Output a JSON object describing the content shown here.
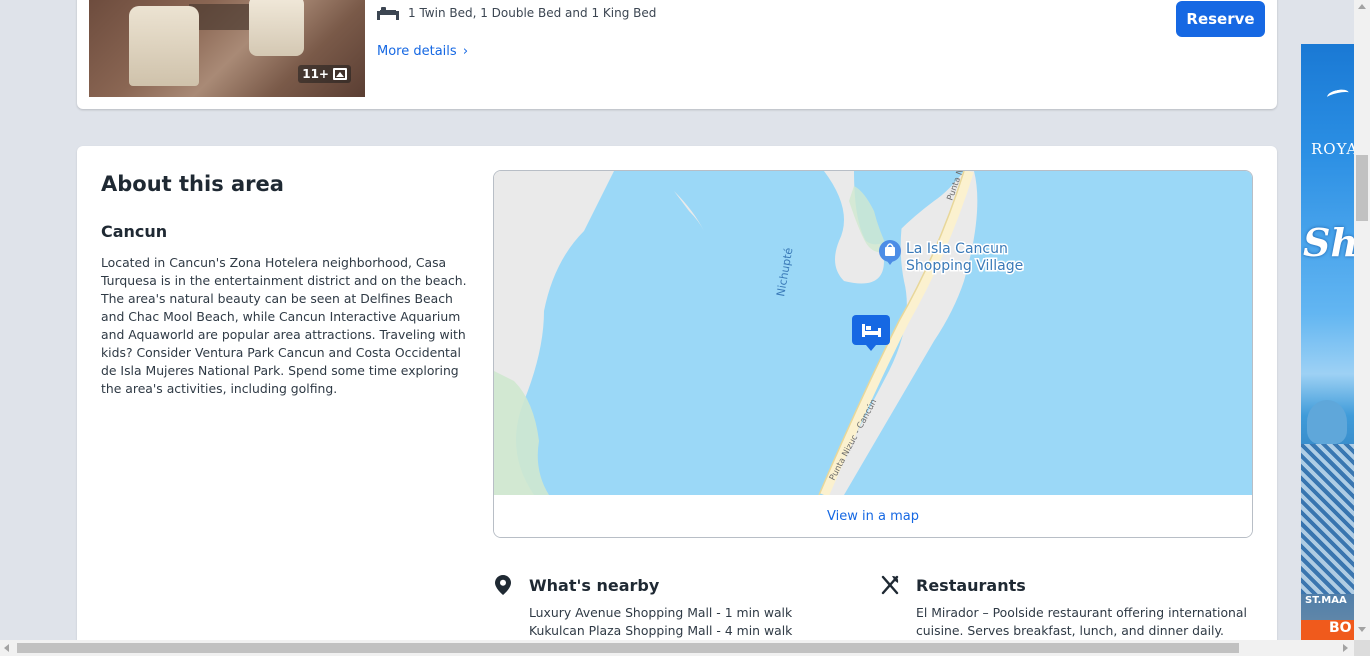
{
  "room": {
    "photo_count": "11+",
    "beds": "1 Twin Bed, 1 Double Bed and 1 King Bed",
    "more_details": "More details",
    "reserve": "Reserve"
  },
  "area": {
    "title": "About this area",
    "city": "Cancun",
    "description": "Located in Cancun's Zona Hotelera neighborhood, Casa Turquesa is in the entertainment district and on the beach. The area's natural beauty can be seen at Delfines Beach and Chac Mool Beach, while Cancun Interactive Aquarium and Aquaworld are popular area attractions. Traveling with kids? Consider Ventura Park Cancun and Costa Occidental de Isla Mujeres National Park. Spend some time exploring the area's activities, including golfing."
  },
  "map": {
    "poi_line1": "La Isla Cancun",
    "poi_line2": "Shopping Village",
    "lagoon": "Nichupté",
    "road_label": "Punta Nizuc - Cancún",
    "road_label_top": "Punta N",
    "view_link": "View in a map",
    "colors": {
      "water": "#9bd8f7",
      "land": "#eaeaea",
      "road": "#fbf1cf",
      "marker": "#1668e3"
    }
  },
  "nearby": {
    "heading": "What's nearby",
    "items": [
      "Luxury Avenue Shopping Mall - 1 min walk",
      "Kukulcan Plaza Shopping Mall - 4 min walk"
    ]
  },
  "restaurants": {
    "heading": "Restaurants",
    "text": "El Mirador – Poolside restaurant offering international cuisine. Serves breakfast, lunch, and dinner daily."
  },
  "ad": {
    "brand": "ROYA",
    "script": "Sh",
    "footer": "ST.MAA",
    "cta": "BO"
  }
}
